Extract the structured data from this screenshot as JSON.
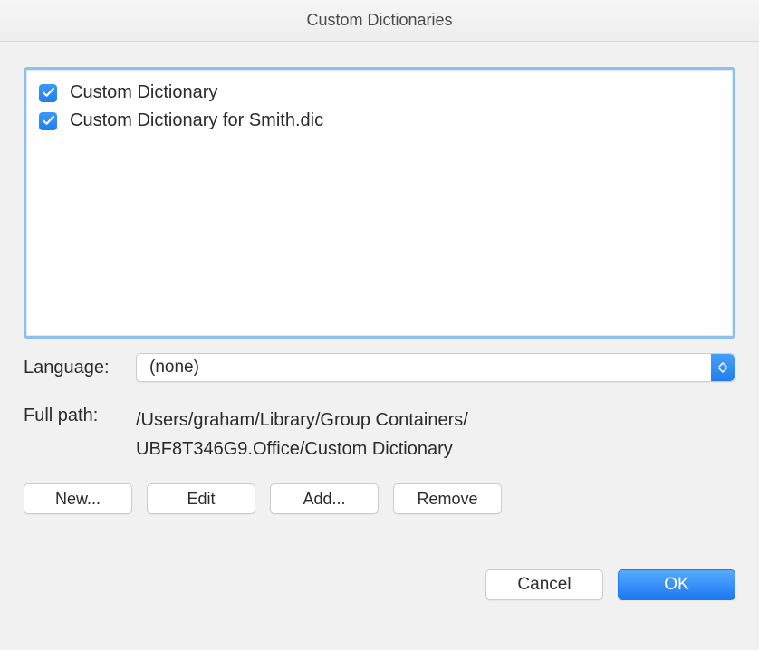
{
  "window": {
    "title": "Custom Dictionaries"
  },
  "dictionaries": [
    {
      "label": "Custom Dictionary",
      "checked": true
    },
    {
      "label": "Custom Dictionary for Smith.dic",
      "checked": true
    }
  ],
  "language": {
    "label": "Language:",
    "value": "(none)"
  },
  "full_path": {
    "label": "Full path:",
    "line1": "/Users/graham/Library/Group Containers/",
    "line2": "UBF8T346G9.Office/Custom Dictionary"
  },
  "buttons": {
    "new": "New...",
    "edit": "Edit",
    "add": "Add...",
    "remove": "Remove",
    "cancel": "Cancel",
    "ok": "OK"
  }
}
